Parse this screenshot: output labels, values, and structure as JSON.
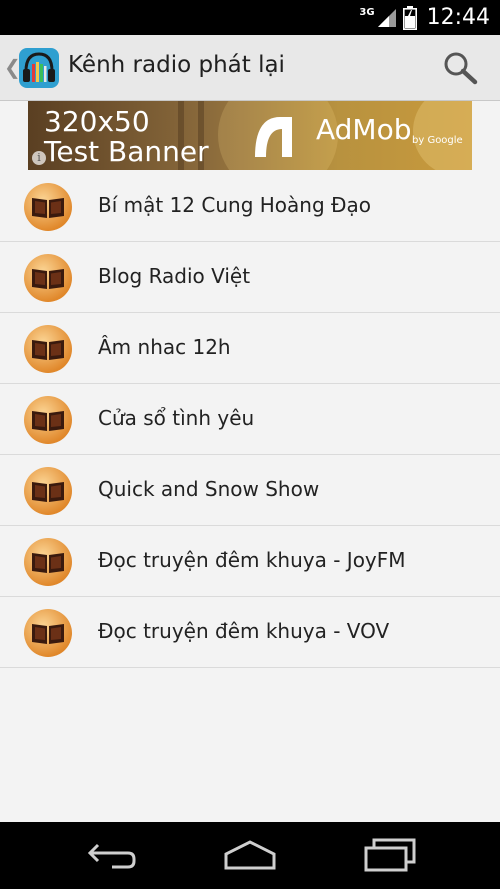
{
  "status_bar": {
    "network_type": "3G",
    "time": "12:44"
  },
  "action_bar": {
    "title": "Kênh radio phát lại",
    "up_icon": "chevron-left-icon",
    "app_icon": "radio-headphones-icon",
    "search_icon": "search-icon"
  },
  "ad_banner": {
    "line1": "320x50",
    "line2": "Test Banner",
    "brand": "AdMob",
    "by": "by Google"
  },
  "stations": [
    {
      "label": "Bí mật 12 Cung Hoàng Đạo",
      "icon": "book-icon"
    },
    {
      "label": "Blog Radio Việt",
      "icon": "book-icon"
    },
    {
      "label": "Âm nhac 12h",
      "icon": "book-icon"
    },
    {
      "label": "Cửa sổ tình yêu",
      "icon": "book-icon"
    },
    {
      "label": "Quick and Snow Show",
      "icon": "book-icon"
    },
    {
      "label": "Đọc truyện đêm khuya - JoyFM",
      "icon": "book-icon"
    },
    {
      "label": "Đọc truyện đêm khuya - VOV",
      "icon": "book-icon"
    }
  ],
  "nav_bar": {
    "buttons": [
      "back-icon",
      "home-icon",
      "recents-icon"
    ]
  },
  "colors": {
    "action_bar_bg": "#e8e8e8",
    "list_bg": "#f3f3f3",
    "icon_orange": "#e8952e"
  }
}
